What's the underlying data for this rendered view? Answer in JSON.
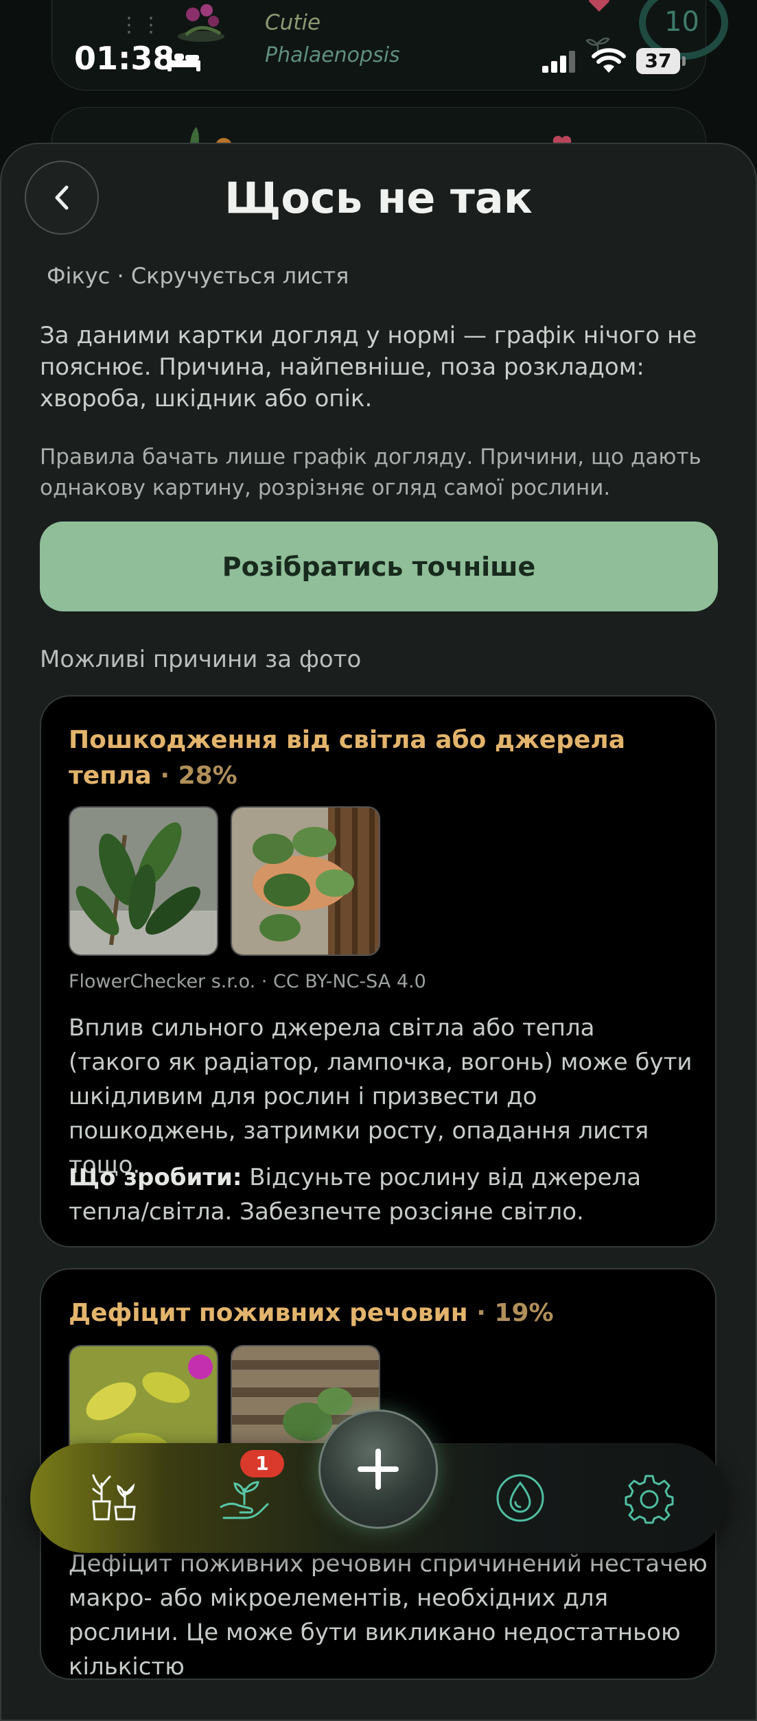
{
  "background_list": {
    "nickname": "Cutie",
    "species": "Phalaenopsis",
    "water_days": "10"
  },
  "status_bar": {
    "time": "01:38",
    "battery": "37"
  },
  "sheet": {
    "title": "Щось не так",
    "breadcrumb": "Фікус · Скручується листя",
    "paragraph1": "За даними картки догляд у нормі — графік нічого не пояснює. Причина, найпевніше, поза розкладом: хвороба, шкідник або опік.",
    "paragraph2": "Правила бачать лише графік догляду. Причини, що дають однакову картину, розрізняє огляд самої рослини.",
    "primary_button": "Розібратись точніше",
    "section_label": "Можливі причини за фото"
  },
  "causes": [
    {
      "title": "Пошкодження від світла або джерела тепла",
      "percent": "· 28%",
      "credit": "FlowerChecker s.r.o. · CC BY-NC-SA 4.0",
      "description": "Вплив сильного джерела світла або тепла (такого як радіатор, лампочка, вогонь) може бути шкідливим для рослин і призвести до пошкоджень, затримки росту, опадання листя тощо.",
      "todo_label": "Що зробити:",
      "todo_text": " Відсуньте рослину від джерела тепла/світла. Забезпечте розсіяне світло."
    },
    {
      "title": "Дефіцит поживних речовин",
      "percent": "· 19%",
      "description": "Дефіцит поживних речовин спричинений нестачею макро- або мікроелементів, необхідних для рослини. Це може бути викликано недостатньою кількістю"
    }
  ],
  "nav": {
    "badge_count": "1"
  },
  "colors": {
    "accent_button": "#8fbe98",
    "cause_title": "#e3b46c",
    "badge": "#d93a2b",
    "sheet_bg": "#1a1e1d"
  },
  "icons": [
    "back-arrow-icon",
    "bed-icon",
    "signal-icon",
    "wifi-icon",
    "plants-icon",
    "plant-care-icon",
    "plus-icon",
    "water-drop-icon",
    "gear-icon"
  ]
}
